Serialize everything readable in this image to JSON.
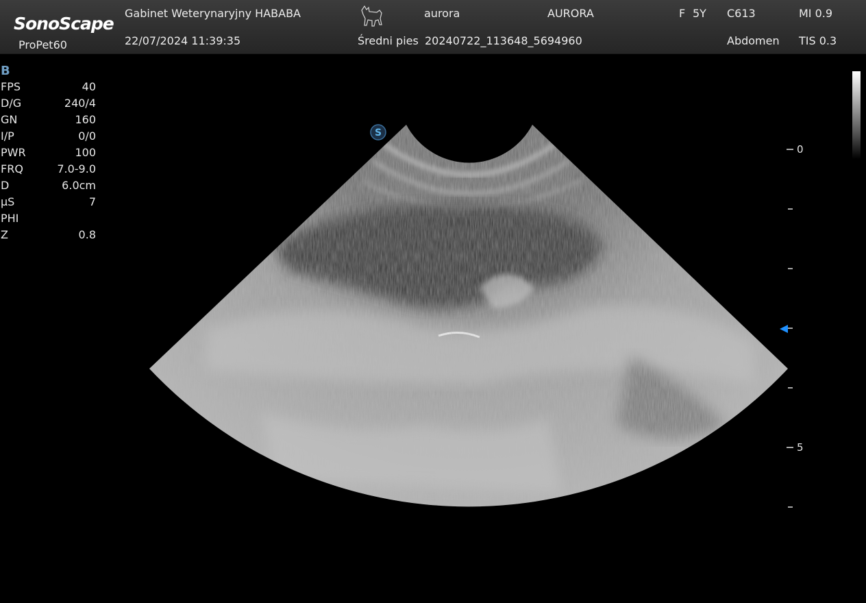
{
  "header": {
    "brand": "SonoScape",
    "model": "ProPet60",
    "clinic": "Gabinet Weterynaryjny HABABA",
    "datetime": "22/07/2024 11:39:35",
    "species_icon": "dog-icon",
    "patient_name": "aurora",
    "patient_id": "AURORA",
    "category": "Średni pies",
    "exam_id": "20240722_113648_5694960",
    "sex": "F",
    "age": "5Y",
    "probe": "C613",
    "preset": "Abdomen",
    "mi": "MI 0.9",
    "tis": "TIS 0.3"
  },
  "imaging": {
    "mode": "B",
    "params": [
      {
        "key": "FPS",
        "value": "40"
      },
      {
        "key": "D/G",
        "value": "240/4"
      },
      {
        "key": "GN",
        "value": "160"
      },
      {
        "key": "I/P",
        "value": "0/0"
      },
      {
        "key": "PWR",
        "value": "100"
      },
      {
        "key": "FRQ",
        "value": "7.0-9.0"
      },
      {
        "key": "D",
        "value": "6.0cm"
      },
      {
        "key": "µS",
        "value": "7"
      },
      {
        "key": "PHI",
        "value": ""
      },
      {
        "key": "Z",
        "value": "0.8"
      }
    ]
  },
  "depth_scale": {
    "labels": [
      "0",
      "5"
    ],
    "focus_color": "#1e90ff"
  },
  "colors": {
    "accent": "#6f9ec4",
    "header_bg": "#333333"
  }
}
